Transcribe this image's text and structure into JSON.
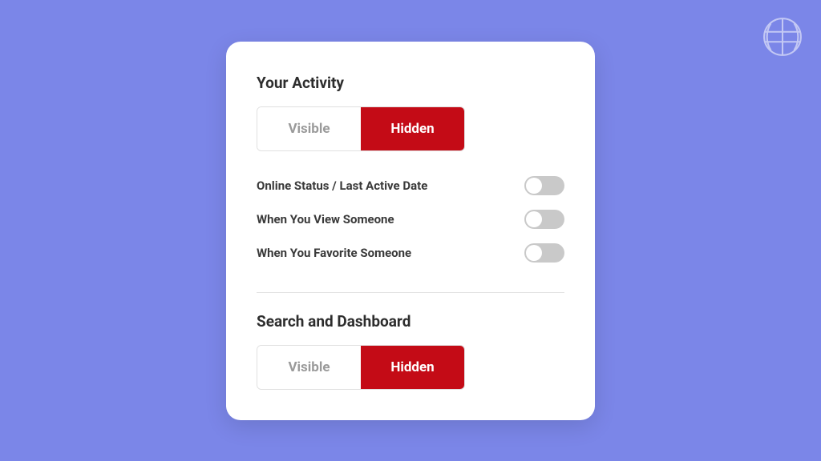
{
  "activity": {
    "title": "Your Activity",
    "visible_label": "Visible",
    "hidden_label": "Hidden",
    "selected": "hidden",
    "options": [
      {
        "label": "Online Status / Last Active Date",
        "value": false
      },
      {
        "label": "When You View Someone",
        "value": false
      },
      {
        "label": "When You Favorite Someone",
        "value": false
      }
    ]
  },
  "search": {
    "title": "Search and Dashboard",
    "visible_label": "Visible",
    "hidden_label": "Hidden",
    "selected": "hidden"
  },
  "colors": {
    "accent": "#c40b16",
    "bg": "#7b86e8"
  }
}
